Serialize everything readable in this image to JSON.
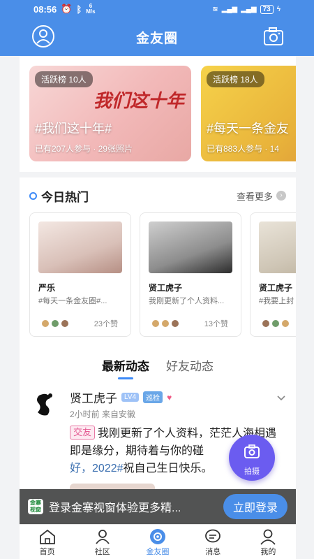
{
  "status": {
    "time": "08:56",
    "speed_value": "6",
    "speed_unit": "M/s",
    "battery": "73"
  },
  "header": {
    "title": "金友圈"
  },
  "banners": [
    {
      "badge": "活跃榜 10人",
      "art": "我们这十年",
      "topic": "#我们这十年#",
      "meta": "已有207人参与 · 29张照片"
    },
    {
      "badge": "活跃榜 18人",
      "art": "",
      "topic": "#每天一条金友",
      "meta": "已有883人参与 · 14"
    }
  ],
  "hot": {
    "title": "今日热门",
    "see_more": "查看更多",
    "cards": [
      {
        "name": "严乐",
        "desc": "#每天一条金友圈#...",
        "likes": "23个赞"
      },
      {
        "name": "贤工虎子",
        "desc": "我刚更新了个人资料...",
        "likes": "13个赞"
      },
      {
        "name": "贤工虎子",
        "desc": "#我要上封",
        "likes": ""
      }
    ]
  },
  "feed_tabs": [
    {
      "label": "最新动态"
    },
    {
      "label": "好友动态"
    }
  ],
  "post": {
    "username": "贤工虎子",
    "level": "LV4",
    "role": "巡检",
    "time": "2小时前 来自安徽",
    "tag": "交友",
    "text": "我刚更新了个人资料，茫茫人海相遇即是缘分，期待着与你的碰",
    "text_tail": "好，",
    "hashtag": "2022#",
    "text_end": "祝自己生日快乐。"
  },
  "fab": {
    "label": "拍摄"
  },
  "login_bar": {
    "logo_text": "金寨视窗",
    "text": "登录金寨视窗体验更多精...",
    "button": "立即登录"
  },
  "bottom_nav": [
    {
      "label": "首页"
    },
    {
      "label": "社区"
    },
    {
      "label": "金友圈"
    },
    {
      "label": "消息"
    },
    {
      "label": "我的"
    }
  ],
  "colors": {
    "brand": "#4a8ee8",
    "fab": "#6b5cf0",
    "tag_pink": "#e45a92"
  }
}
